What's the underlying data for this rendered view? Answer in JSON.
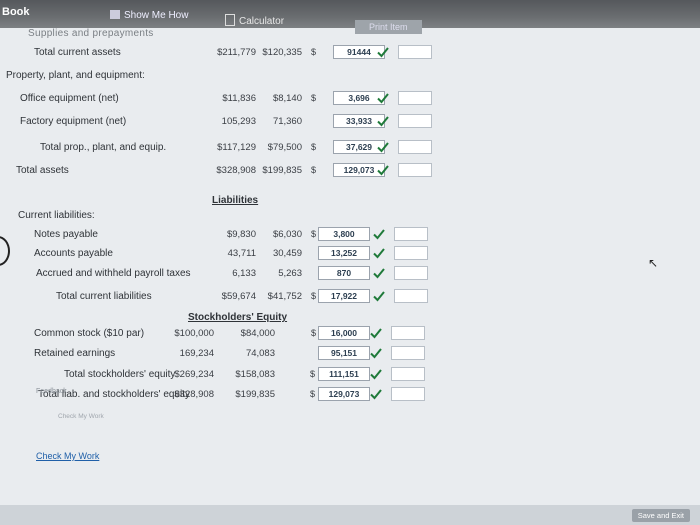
{
  "topbar": {
    "book": "Book",
    "show_me_how": "Show Me How",
    "calculator": "Calculator",
    "print_item": "Print Item"
  },
  "cut_text": "Supplies and prepayments",
  "rows": [
    {
      "label": "Total current assets",
      "c1": "$211,779",
      "c2": "$120,335",
      "dollar": "$",
      "input": "91444",
      "check": true
    },
    {
      "label": "Property, plant, and equipment:",
      "header": true
    },
    {
      "label": "Office equipment (net)",
      "c1": "$11,836",
      "c2": "$8,140",
      "dollar": "$",
      "input": "3,696",
      "check": true
    },
    {
      "label": "Factory equipment (net)",
      "c1": "105,293",
      "c2": "71,360",
      "input": "33,933",
      "check": true
    },
    {
      "label": "Total prop., plant, and equip.",
      "c1": "$117,129",
      "c2": "$79,500",
      "dollar": "$",
      "input": "37,629",
      "check": true
    },
    {
      "label": "Total assets",
      "c1": "$328,908",
      "c2": "$199,835",
      "dollar": "$",
      "input": "129,073",
      "check": true
    },
    {
      "label": "Liabilities",
      "section": true
    },
    {
      "label": "Current liabilities:",
      "header": true
    },
    {
      "label": "Notes payable",
      "c1": "$9,830",
      "c2": "$6,030",
      "dollar": "$",
      "input": "3,800",
      "check": true
    },
    {
      "label": "Accounts payable",
      "c1": "43,711",
      "c2": "30,459",
      "input": "13,252",
      "check": true
    },
    {
      "label": "Accrued and withheld payroll taxes",
      "c1": "6,133",
      "c2": "5,263",
      "input": "870",
      "check": true
    },
    {
      "label": "Total current liabilities",
      "c1": "$59,674",
      "c2": "$41,752",
      "dollar": "$",
      "input": "17,922",
      "check": true
    },
    {
      "label": "Stockholders' Equity",
      "section": true
    },
    {
      "label": "Common stock ($10 par)",
      "c1": "$100,000",
      "c2": "$84,000",
      "dollar": "$",
      "input": "16,000",
      "check": true
    },
    {
      "label": "Retained earnings",
      "c1": "169,234",
      "c2": "74,083",
      "input": "95,151",
      "check": true
    },
    {
      "label": "Total stockholders' equity",
      "c1": "$269,234",
      "c2": "$158,083",
      "dollar": "$",
      "input": "111,151",
      "check": true
    },
    {
      "label": "Total liab. and stockholders' equity",
      "c1": "$328,908",
      "c2": "$199,835",
      "dollar": "$",
      "input": "129,073",
      "check": true
    }
  ],
  "feedback": {
    "title": "Feedback",
    "subtitle": "Check My Work"
  },
  "check_my_work": "Check My Work",
  "save_exit": "Save and Exit",
  "colors": {
    "check": "#1f7a3a",
    "link": "#1f5fa8"
  }
}
